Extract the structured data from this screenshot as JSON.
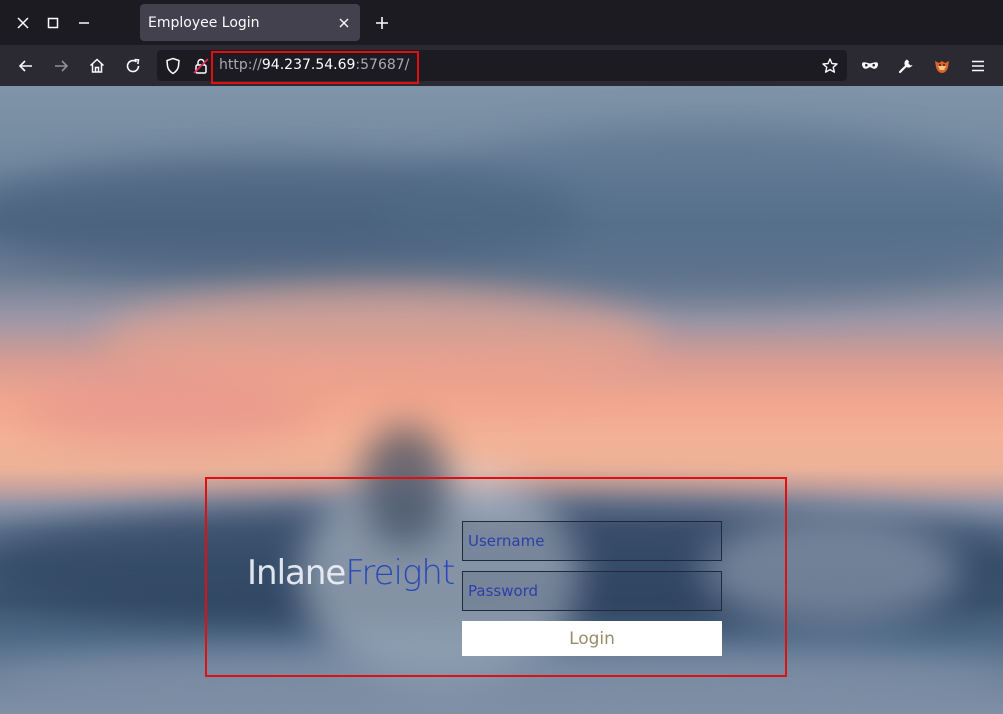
{
  "browser": {
    "tab_title": "Employee Login",
    "url_scheme": "http://",
    "url_host": "94.237.54.69",
    "url_port": ":57687/",
    "colors": {
      "tab_bg": "#42414d",
      "toolbar_bg": "#2b2a33",
      "highlight": "#e01010"
    }
  },
  "login": {
    "brand_part1": "Inlane",
    "brand_part2": "Freight",
    "username_placeholder": "Username",
    "password_placeholder": "Password",
    "login_label": "Login",
    "colors": {
      "brand_accent": "#2848b8",
      "button_text": "#9c8b6a"
    }
  }
}
